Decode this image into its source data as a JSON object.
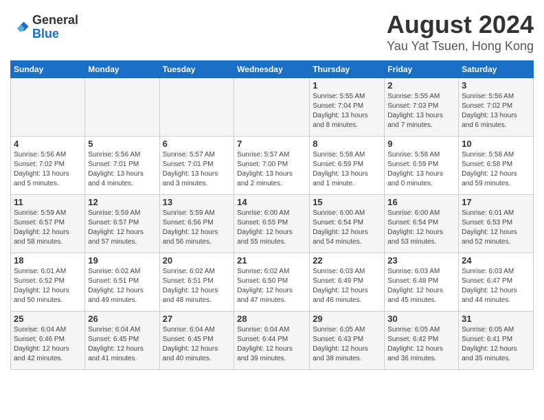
{
  "header": {
    "logo_line1": "General",
    "logo_line2": "Blue",
    "month_title": "August 2024",
    "location": "Yau Yat Tsuen, Hong Kong"
  },
  "weekdays": [
    "Sunday",
    "Monday",
    "Tuesday",
    "Wednesday",
    "Thursday",
    "Friday",
    "Saturday"
  ],
  "weeks": [
    [
      {
        "day": "",
        "detail": ""
      },
      {
        "day": "",
        "detail": ""
      },
      {
        "day": "",
        "detail": ""
      },
      {
        "day": "",
        "detail": ""
      },
      {
        "day": "1",
        "detail": "Sunrise: 5:55 AM\nSunset: 7:04 PM\nDaylight: 13 hours\nand 8 minutes."
      },
      {
        "day": "2",
        "detail": "Sunrise: 5:55 AM\nSunset: 7:03 PM\nDaylight: 13 hours\nand 7 minutes."
      },
      {
        "day": "3",
        "detail": "Sunrise: 5:56 AM\nSunset: 7:02 PM\nDaylight: 13 hours\nand 6 minutes."
      }
    ],
    [
      {
        "day": "4",
        "detail": "Sunrise: 5:56 AM\nSunset: 7:02 PM\nDaylight: 13 hours\nand 5 minutes."
      },
      {
        "day": "5",
        "detail": "Sunrise: 5:56 AM\nSunset: 7:01 PM\nDaylight: 13 hours\nand 4 minutes."
      },
      {
        "day": "6",
        "detail": "Sunrise: 5:57 AM\nSunset: 7:01 PM\nDaylight: 13 hours\nand 3 minutes."
      },
      {
        "day": "7",
        "detail": "Sunrise: 5:57 AM\nSunset: 7:00 PM\nDaylight: 13 hours\nand 2 minutes."
      },
      {
        "day": "8",
        "detail": "Sunrise: 5:58 AM\nSunset: 6:59 PM\nDaylight: 13 hours\nand 1 minute."
      },
      {
        "day": "9",
        "detail": "Sunrise: 5:58 AM\nSunset: 6:59 PM\nDaylight: 13 hours\nand 0 minutes."
      },
      {
        "day": "10",
        "detail": "Sunrise: 5:58 AM\nSunset: 6:58 PM\nDaylight: 12 hours\nand 59 minutes."
      }
    ],
    [
      {
        "day": "11",
        "detail": "Sunrise: 5:59 AM\nSunset: 6:57 PM\nDaylight: 12 hours\nand 58 minutes."
      },
      {
        "day": "12",
        "detail": "Sunrise: 5:59 AM\nSunset: 6:57 PM\nDaylight: 12 hours\nand 57 minutes."
      },
      {
        "day": "13",
        "detail": "Sunrise: 5:59 AM\nSunset: 6:56 PM\nDaylight: 12 hours\nand 56 minutes."
      },
      {
        "day": "14",
        "detail": "Sunrise: 6:00 AM\nSunset: 6:55 PM\nDaylight: 12 hours\nand 55 minutes."
      },
      {
        "day": "15",
        "detail": "Sunrise: 6:00 AM\nSunset: 6:54 PM\nDaylight: 12 hours\nand 54 minutes."
      },
      {
        "day": "16",
        "detail": "Sunrise: 6:00 AM\nSunset: 6:54 PM\nDaylight: 12 hours\nand 53 minutes."
      },
      {
        "day": "17",
        "detail": "Sunrise: 6:01 AM\nSunset: 6:53 PM\nDaylight: 12 hours\nand 52 minutes."
      }
    ],
    [
      {
        "day": "18",
        "detail": "Sunrise: 6:01 AM\nSunset: 6:52 PM\nDaylight: 12 hours\nand 50 minutes."
      },
      {
        "day": "19",
        "detail": "Sunrise: 6:02 AM\nSunset: 6:51 PM\nDaylight: 12 hours\nand 49 minutes."
      },
      {
        "day": "20",
        "detail": "Sunrise: 6:02 AM\nSunset: 6:51 PM\nDaylight: 12 hours\nand 48 minutes."
      },
      {
        "day": "21",
        "detail": "Sunrise: 6:02 AM\nSunset: 6:50 PM\nDaylight: 12 hours\nand 47 minutes."
      },
      {
        "day": "22",
        "detail": "Sunrise: 6:03 AM\nSunset: 6:49 PM\nDaylight: 12 hours\nand 46 minutes."
      },
      {
        "day": "23",
        "detail": "Sunrise: 6:03 AM\nSunset: 6:48 PM\nDaylight: 12 hours\nand 45 minutes."
      },
      {
        "day": "24",
        "detail": "Sunrise: 6:03 AM\nSunset: 6:47 PM\nDaylight: 12 hours\nand 44 minutes."
      }
    ],
    [
      {
        "day": "25",
        "detail": "Sunrise: 6:04 AM\nSunset: 6:46 PM\nDaylight: 12 hours\nand 42 minutes."
      },
      {
        "day": "26",
        "detail": "Sunrise: 6:04 AM\nSunset: 6:45 PM\nDaylight: 12 hours\nand 41 minutes."
      },
      {
        "day": "27",
        "detail": "Sunrise: 6:04 AM\nSunset: 6:45 PM\nDaylight: 12 hours\nand 40 minutes."
      },
      {
        "day": "28",
        "detail": "Sunrise: 6:04 AM\nSunset: 6:44 PM\nDaylight: 12 hours\nand 39 minutes."
      },
      {
        "day": "29",
        "detail": "Sunrise: 6:05 AM\nSunset: 6:43 PM\nDaylight: 12 hours\nand 38 minutes."
      },
      {
        "day": "30",
        "detail": "Sunrise: 6:05 AM\nSunset: 6:42 PM\nDaylight: 12 hours\nand 36 minutes."
      },
      {
        "day": "31",
        "detail": "Sunrise: 6:05 AM\nSunset: 6:41 PM\nDaylight: 12 hours\nand 35 minutes."
      }
    ]
  ]
}
